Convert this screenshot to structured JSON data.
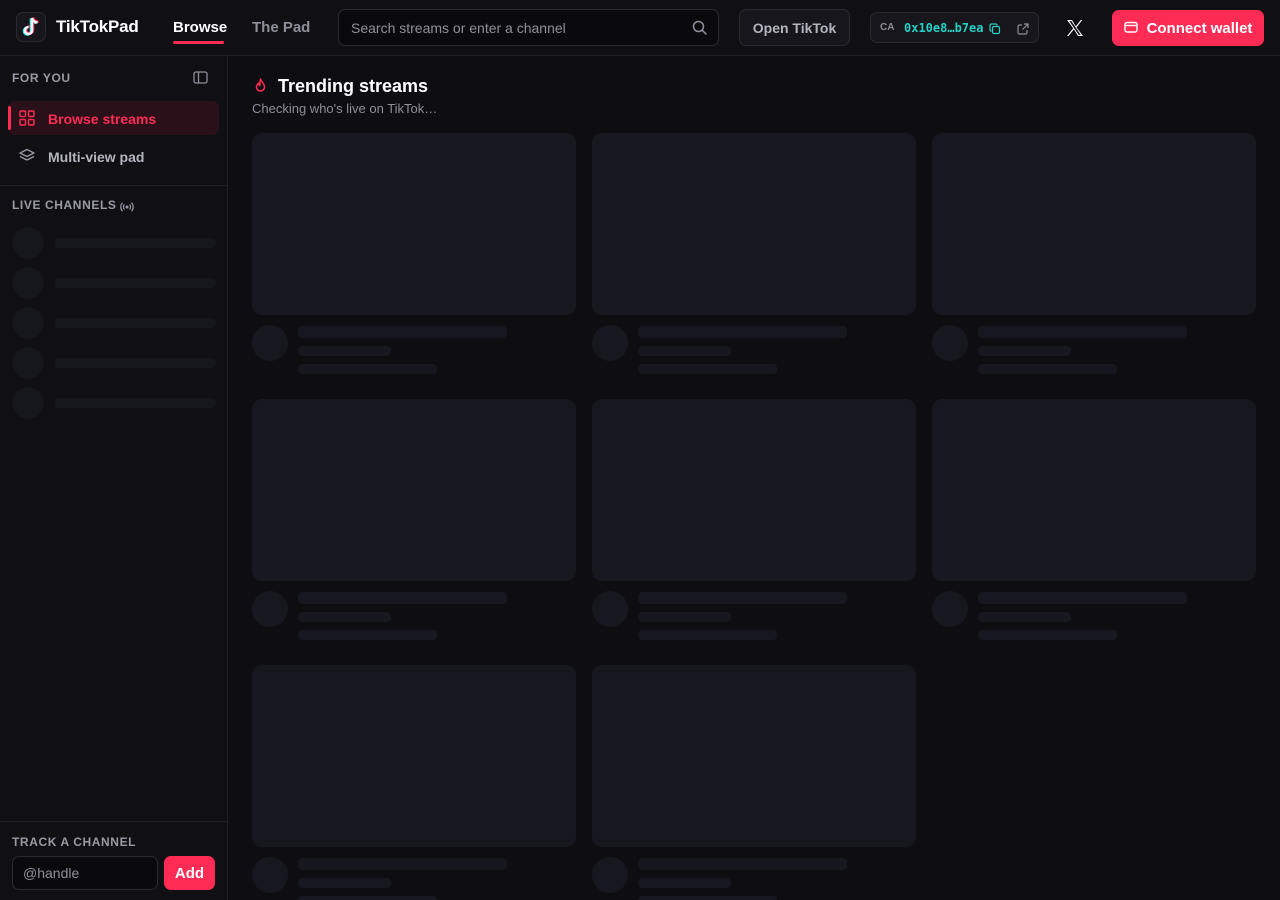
{
  "app": {
    "name": "TikTokPad",
    "logo_icon": "tiktok-logo-icon"
  },
  "header": {
    "tabs": [
      {
        "label": "Browse",
        "active": true
      },
      {
        "label": "The Pad",
        "active": false
      }
    ],
    "search": {
      "placeholder": "Search streams or enter a channel",
      "value": ""
    },
    "open_tiktok_label": "Open TikTok",
    "contract": {
      "label": "CA",
      "address": "0x10e8…b7ea"
    },
    "connect_wallet_label": "Connect wallet"
  },
  "sidebar": {
    "for_you_title": "FOR YOU",
    "items": [
      {
        "label": "Browse streams",
        "icon": "grid-icon",
        "active": true
      },
      {
        "label": "Multi-view pad",
        "icon": "layers-icon",
        "active": false
      }
    ],
    "live_channels_title": "LIVE CHANNELS",
    "live_channels_loading_count": 5,
    "track_title": "TRACK A CHANNEL",
    "handle_placeholder": "@handle",
    "add_label": "Add"
  },
  "main": {
    "title": "Trending streams",
    "subtitle": "Checking who's live on TikTok…",
    "loading_cards": 8
  },
  "colors": {
    "accent": "#fe2c55",
    "contract_text": "#25d0c4",
    "background": "#0d0d12",
    "skeleton": "#17171f"
  }
}
